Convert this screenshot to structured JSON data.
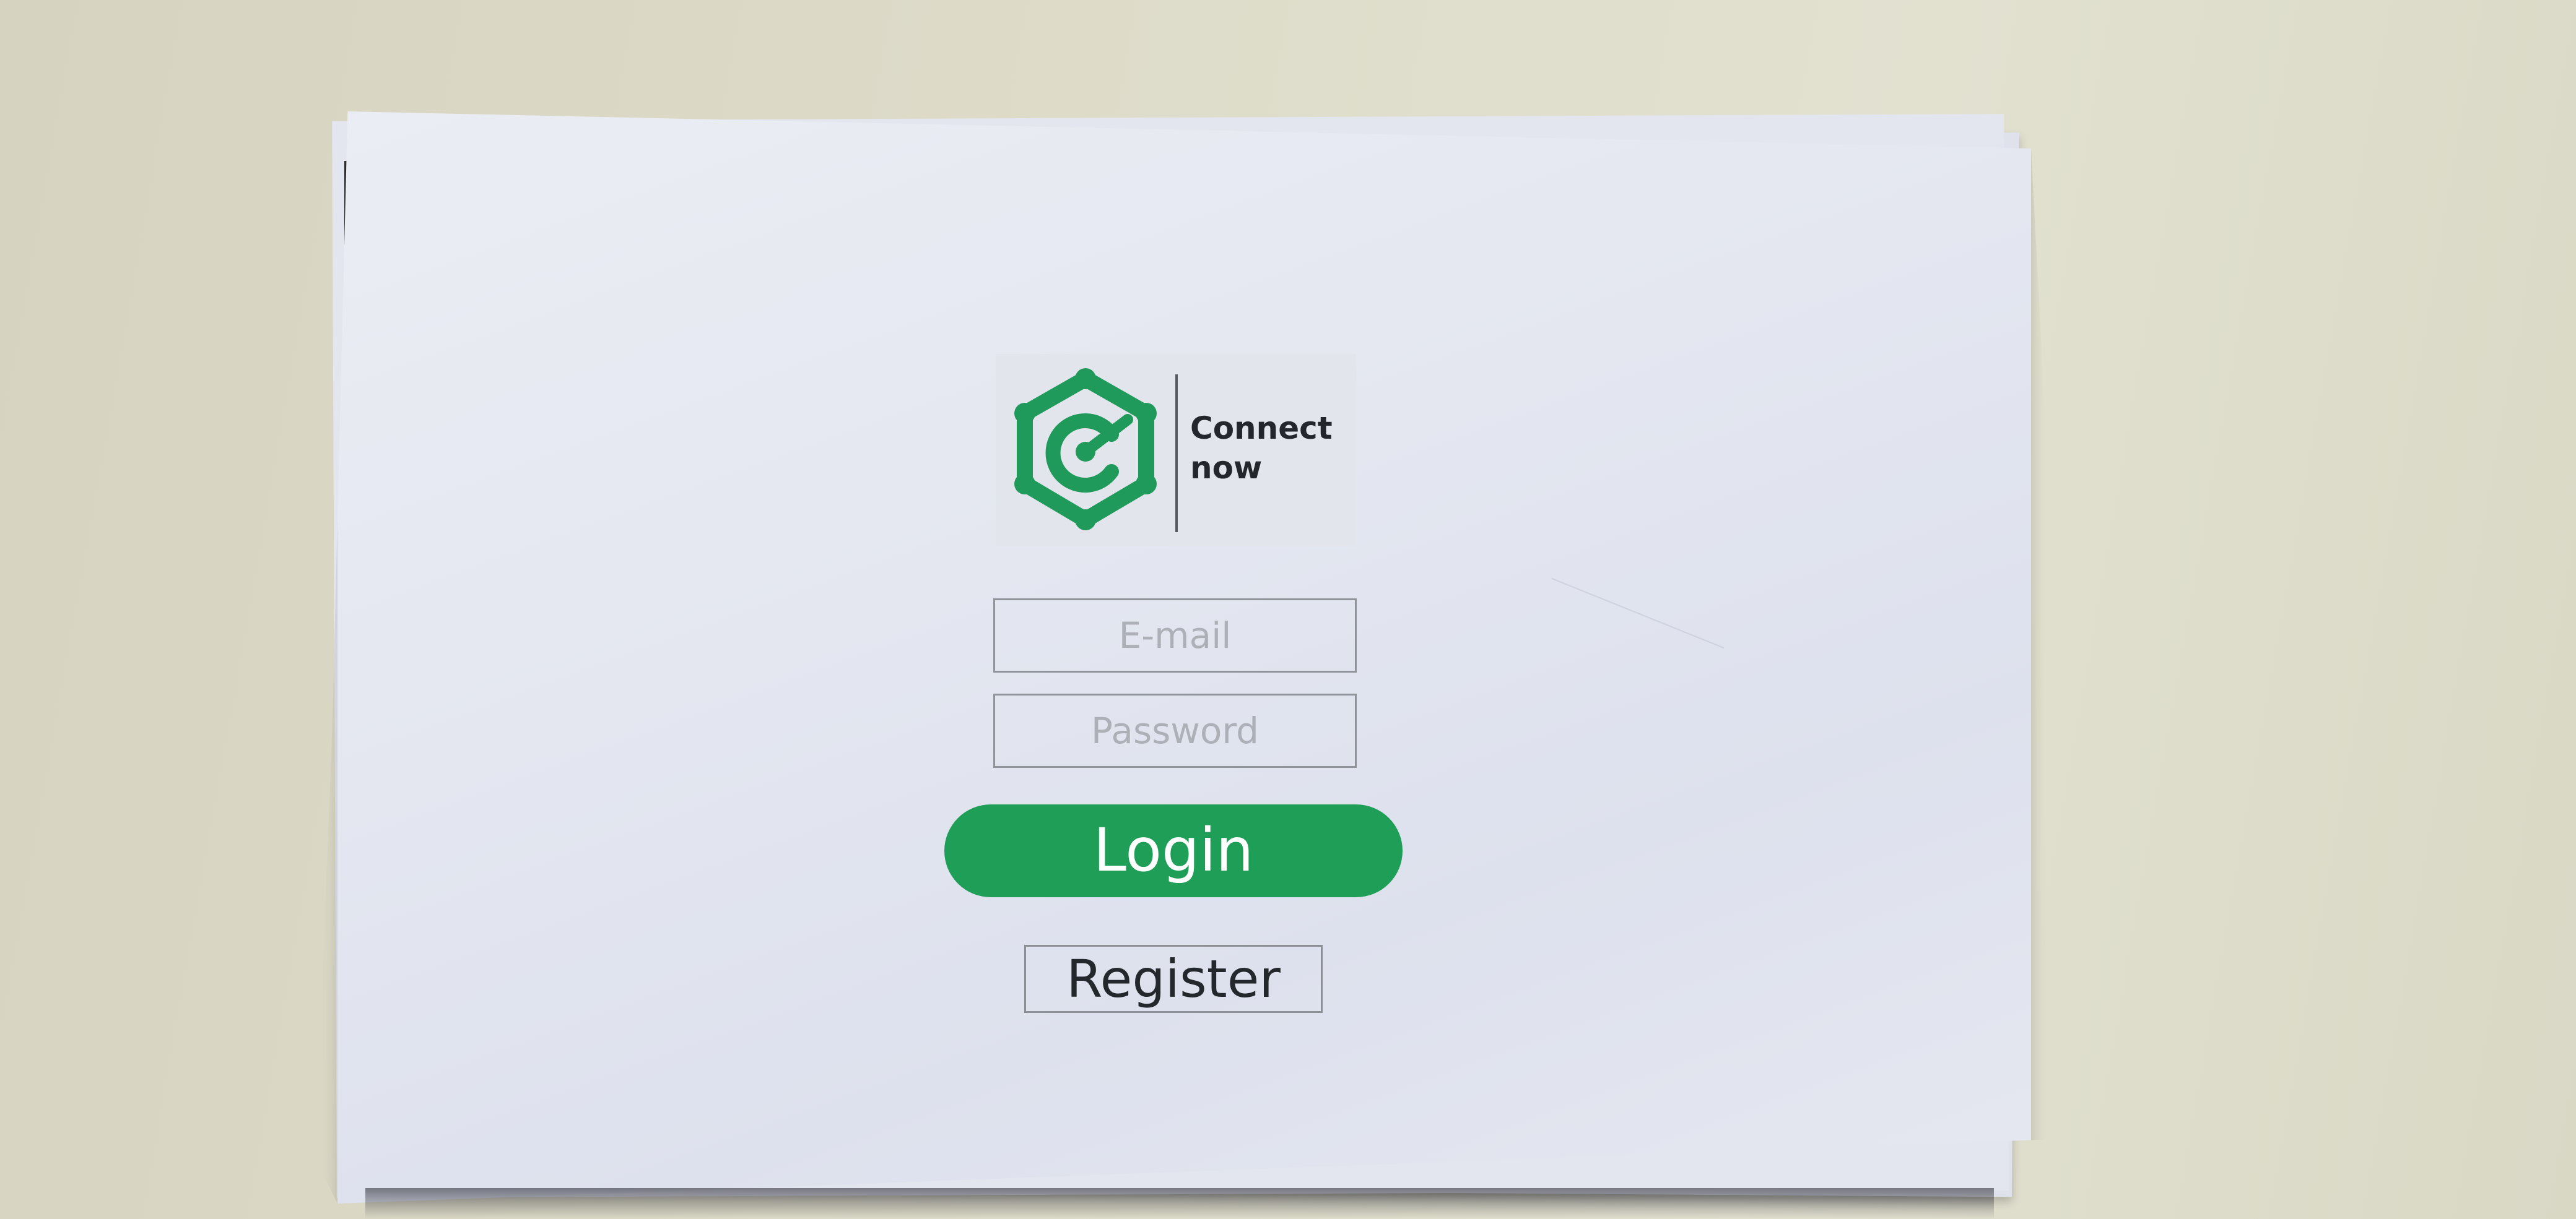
{
  "brand": {
    "name_line1": "Connect",
    "name_line2": "now",
    "accent_color": "#1e9e56",
    "logo_icon": "hexagon-c-network-icon"
  },
  "form": {
    "email_placeholder": "E-mail",
    "password_placeholder": "Password",
    "login_label": "Login",
    "register_label": "Register"
  }
}
